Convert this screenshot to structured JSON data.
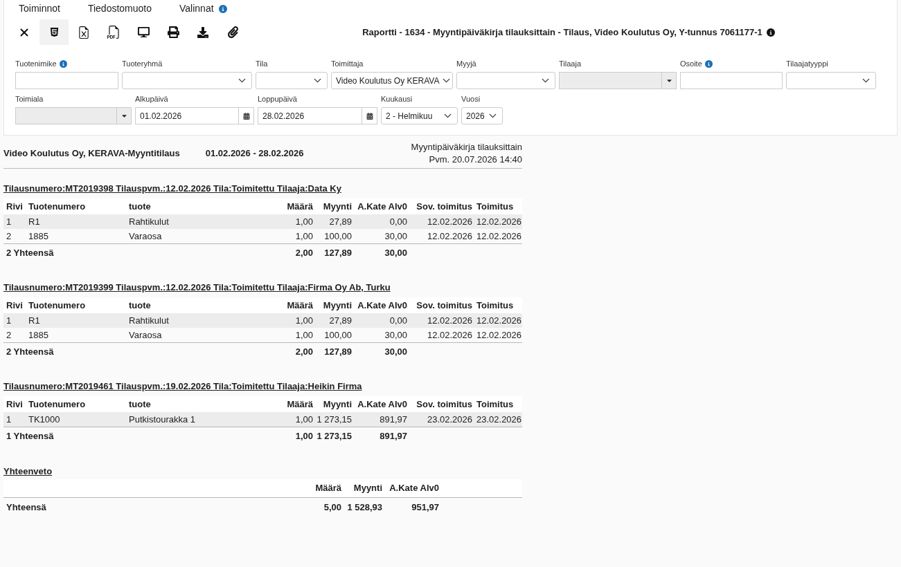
{
  "menu": [
    {
      "label": "Toiminnot",
      "info": false
    },
    {
      "label": "Tiedostomuoto",
      "info": false
    },
    {
      "label": "Valinnat",
      "info": true
    }
  ],
  "toolbar": [
    {
      "kind": "close",
      "selected": false
    },
    {
      "kind": "html",
      "selected": true
    },
    {
      "kind": "excel",
      "selected": false
    },
    {
      "kind": "pdf",
      "selected": false
    },
    {
      "kind": "screen",
      "selected": false
    },
    {
      "kind": "print",
      "selected": false
    },
    {
      "kind": "download",
      "selected": false
    },
    {
      "kind": "attach",
      "selected": false
    }
  ],
  "title": "Raportti - 1634 - Myyntipäiväkirja tilauksittain - Tilaus, Video Koulutus Oy, Y-tunnus 7061177-1",
  "filters": [
    {
      "fields": [
        {
          "label": "Tuotenimike",
          "kind": "text",
          "info": true,
          "disabled": false
        },
        {
          "label": "Tuoteryhmä",
          "kind": "select",
          "info": false,
          "disabled": false
        },
        {
          "label": "Tila",
          "kind": "select",
          "info": false,
          "disabled": false
        },
        {
          "label": "Toimittaja",
          "kind": "select",
          "value": "Video Koulutus Oy KERAVA",
          "info": false,
          "disabled": false
        },
        {
          "label": "Myyjä",
          "kind": "select",
          "info": false,
          "disabled": false
        },
        {
          "label": "Tilaaja",
          "kind": "lookup",
          "info": false,
          "disabled": true
        },
        {
          "label": "Osoite",
          "kind": "text",
          "info": true,
          "disabled": false
        },
        {
          "label": "Tilaajatyyppi",
          "kind": "select",
          "info": false,
          "disabled": false
        }
      ]
    },
    {
      "fields": [
        {
          "label": "Toimiala",
          "kind": "lookup",
          "info": false,
          "disabled": true
        },
        {
          "label": "Alkupäivä",
          "kind": "date",
          "value": "01.02.2026",
          "info": false,
          "disabled": false
        },
        {
          "label": "Loppupäivä",
          "kind": "date",
          "value": "28.02.2026",
          "info": false,
          "disabled": false
        },
        {
          "label": "Kuukausi",
          "kind": "select",
          "value": "2 - Helmikuu",
          "info": false,
          "disabled": false
        },
        {
          "label": "Vuosi",
          "kind": "select",
          "value": "2026",
          "info": false,
          "disabled": false
        }
      ]
    }
  ],
  "report": {
    "company": "Video Koulutus Oy, KERAVA-Myyntitilaus",
    "period": "01.02.2026 - 28.02.2026",
    "report_name": "Myyntipäiväkirja tilauksittain",
    "printed": "Pvm. 20.07.2026 14:40"
  },
  "orders": [
    {
      "heading": "Tilausnumero:MT2019398 Tilauspvm.:12.02.2026 Tila:Toimitettu Tilaaja:Data Ky",
      "columns": [
        "Rivi",
        "Tuotenumero",
        "tuote",
        "Määrä",
        "Myynti",
        "A.Kate Alv0",
        "Sov. toimitus",
        "Toimitus"
      ],
      "rows": [
        [
          "1",
          "R1",
          "Rahtikulut",
          "1,00",
          "27,89",
          "0,00",
          "12.02.2026",
          "12.02.2026"
        ],
        [
          "2",
          "1885",
          "Varaosa",
          "1,00",
          "100,00",
          "30,00",
          "12.02.2026",
          "12.02.2026"
        ]
      ],
      "total": {
        "label": "2 Yhteensä",
        "values": [
          "2,00",
          "127,89",
          "30,00"
        ]
      }
    },
    {
      "heading": "Tilausnumero:MT2019399 Tilauspvm.:12.02.2026 Tila:Toimitettu Tilaaja:Firma Oy Ab, Turku",
      "columns": [
        "Rivi",
        "Tuotenumero",
        "tuote",
        "Määrä",
        "Myynti",
        "A.Kate Alv0",
        "Sov. toimitus",
        "Toimitus"
      ],
      "rows": [
        [
          "1",
          "R1",
          "Rahtikulut",
          "1,00",
          "27,89",
          "0,00",
          "12.02.2026",
          "12.02.2026"
        ],
        [
          "2",
          "1885",
          "Varaosa",
          "1,00",
          "100,00",
          "30,00",
          "12.02.2026",
          "12.02.2026"
        ]
      ],
      "total": {
        "label": "2 Yhteensä",
        "values": [
          "2,00",
          "127,89",
          "30,00"
        ]
      }
    },
    {
      "heading": "Tilausnumero:MT2019461 Tilauspvm.:19.02.2026 Tila:Toimitettu Tilaaja:Heikin Firma",
      "columns": [
        "Rivi",
        "Tuotenumero",
        "tuote",
        "Määrä",
        "Myynti",
        "A.Kate Alv0",
        "Sov. toimitus",
        "Toimitus"
      ],
      "rows": [
        [
          "1",
          "TK1000",
          "Putkistourakka 1",
          "1,00",
          "1 273,15",
          "891,97",
          "23.02.2026",
          "23.02.2026"
        ]
      ],
      "total": {
        "label": "1 Yhteensä",
        "values": [
          "1,00",
          "1 273,15",
          "891,97"
        ]
      }
    }
  ],
  "summary": {
    "title": "Yhteenveto",
    "columns": [
      "Määrä",
      "Myynti",
      "A.Kate Alv0"
    ],
    "total": {
      "label": "Yhteensä",
      "values": [
        "5,00",
        "1 528,93",
        "951,97"
      ]
    }
  }
}
